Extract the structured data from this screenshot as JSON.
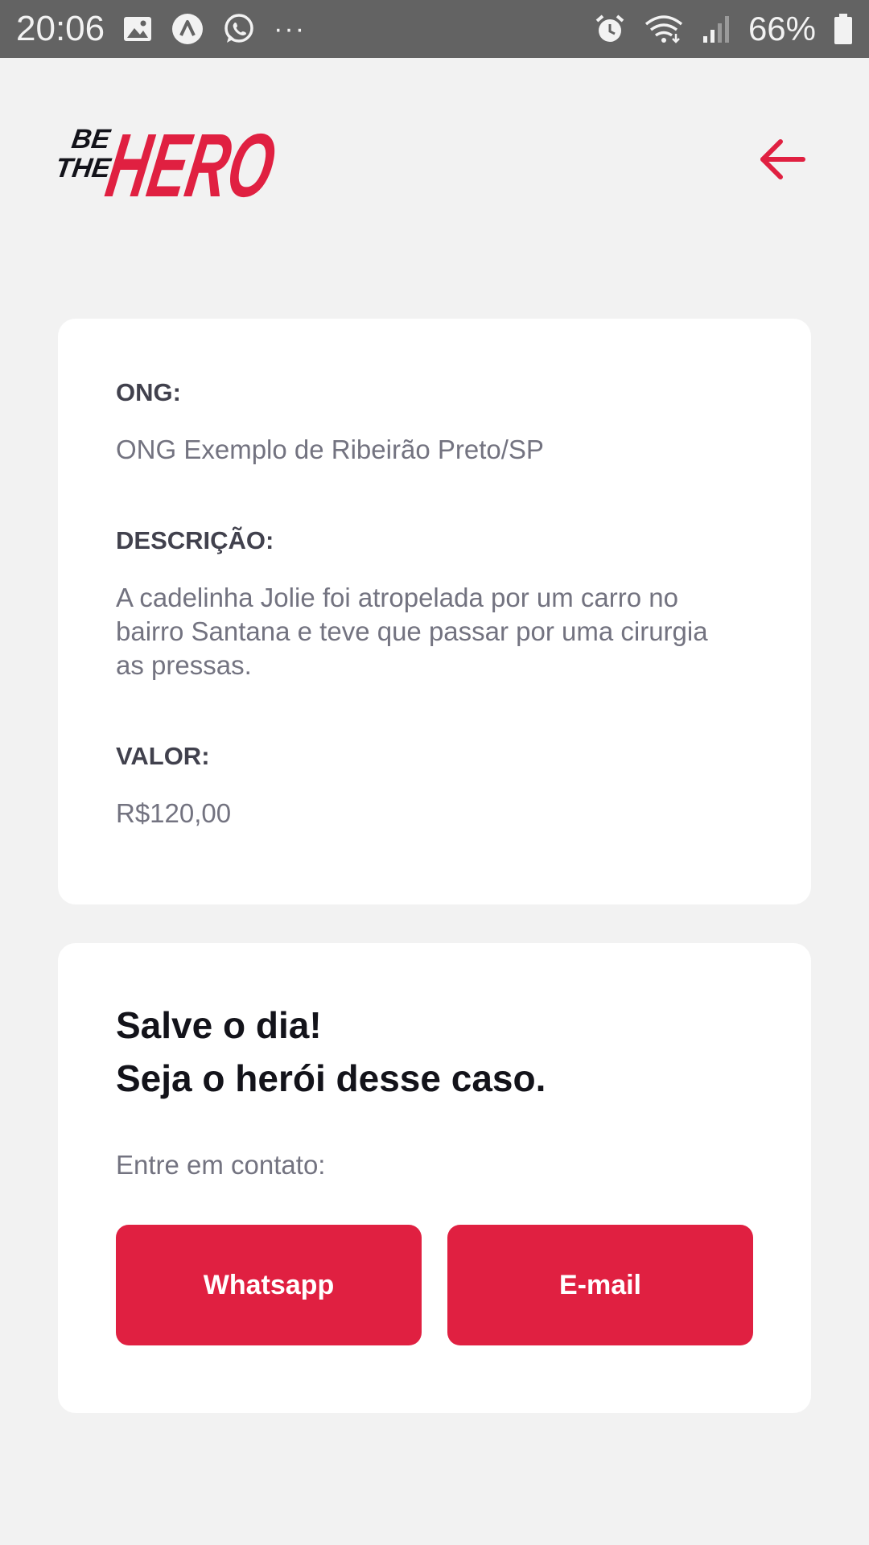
{
  "status_bar": {
    "time": "20:06",
    "battery_percent": "66%",
    "overflow": "···",
    "left_icons": [
      "gallery-icon",
      "app-icon",
      "whatsapp-icon",
      "more-icon"
    ],
    "right_icons": [
      "alarm-icon",
      "wifi-icon",
      "signal-icon",
      "battery-icon"
    ]
  },
  "header": {
    "logo_small_line1": "BE",
    "logo_small_line2": "THE",
    "logo_big": "HERO",
    "back_icon": "arrow-left-icon"
  },
  "incident": {
    "ong_label": "ONG:",
    "ong_value": "ONG Exemplo de Ribeirão Preto/SP",
    "description_label": "DESCRIÇÃO:",
    "description_value": "A cadelinha Jolie foi atropelada por um carro no bairro Santana e teve que passar por uma cirurgia as pressas.",
    "value_label": "VALOR:",
    "value_value": "R$120,00"
  },
  "contact": {
    "title_line1": "Salve o dia!",
    "title_line2": "Seja o herói desse caso.",
    "description": "Entre em contato:",
    "whatsapp_label": "Whatsapp",
    "email_label": "E-mail"
  },
  "colors": {
    "accent": "#e02041",
    "background": "#f2f2f2",
    "card": "#ffffff",
    "status_bar": "#636363"
  }
}
